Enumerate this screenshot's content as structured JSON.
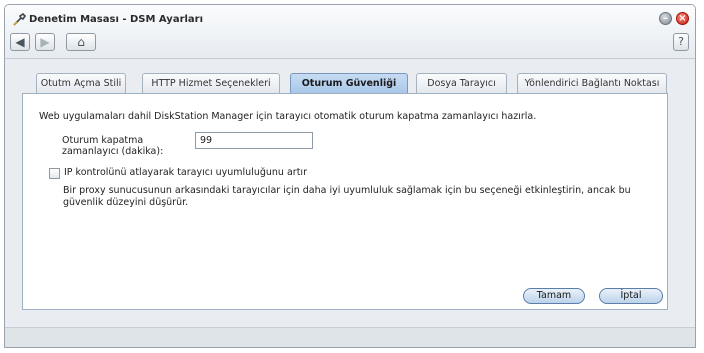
{
  "window": {
    "title": "Denetim Masası - DSM Ayarları",
    "minimize_symbol": "–",
    "close_symbol": "×"
  },
  "toolbar": {
    "back_icon": "◀",
    "forward_icon": "▶",
    "home_icon": "⌂",
    "help_label": "?"
  },
  "tabs": [
    {
      "label": "Otutm Açma Stili",
      "active": false
    },
    {
      "label": "HTTP Hizmet Seçenekleri",
      "active": false
    },
    {
      "label": "Oturum Güvenliği",
      "active": true
    },
    {
      "label": "Dosya Tarayıcı",
      "active": false
    },
    {
      "label": "Yönlendirici Bağlantı Noktası",
      "active": false
    }
  ],
  "form": {
    "description": "Web uygulamaları dahil DiskStation Manager için tarayıcı otomatik oturum kapatma zamanlayıcı hazırla.",
    "timeout_label": "Oturum kapatma zamanlayıcı (dakika):",
    "timeout_value": "99",
    "ip_check_label": "IP kontrolünü atlayarak tarayıcı uyumluluğunu artır",
    "ip_check_checked": false,
    "note": "Bir proxy sunucusunun arkasındaki tarayıcılar için daha iyi uyumluluk sağlamak için bu seçeneği etkinleştirin, ancak bu güvenlik düzeyini düşürür."
  },
  "buttons": {
    "ok_label": "Tamam",
    "cancel_label": "İptal"
  },
  "colors": {
    "active_tab": "#a8c6e8",
    "close_button": "#c41f12"
  }
}
